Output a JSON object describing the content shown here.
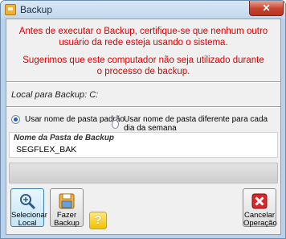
{
  "window": {
    "title": "Backup",
    "close_glyph": "✕"
  },
  "warning": {
    "line1": "Antes de executar o Backup, certifique-se que nenhum outro usuário da rede esteja usando o sistema.",
    "line2": "Sugerimos que este computador não seja utilizado durante o processo de backup."
  },
  "local": {
    "label": "Local para Backup: C:"
  },
  "options": {
    "opt1": "Usar nome de pasta padrão",
    "opt2": "Usar nome de pasta diferente para cada dia da semana",
    "selected": "opt1"
  },
  "folder": {
    "label": "Nome da Pasta de Backup",
    "value": "SEGFLEX_BAK"
  },
  "progress": {
    "value": 0
  },
  "buttons": {
    "select_line1": "Selecionar",
    "select_line2": "Local",
    "backup_line1": "Fazer",
    "backup_line2": "Backup",
    "help_glyph": "?",
    "cancel_line1": "Cancelar",
    "cancel_line2": "Operação"
  },
  "colors": {
    "warning_text": "#e10000",
    "accent": "#3c7fb1"
  }
}
